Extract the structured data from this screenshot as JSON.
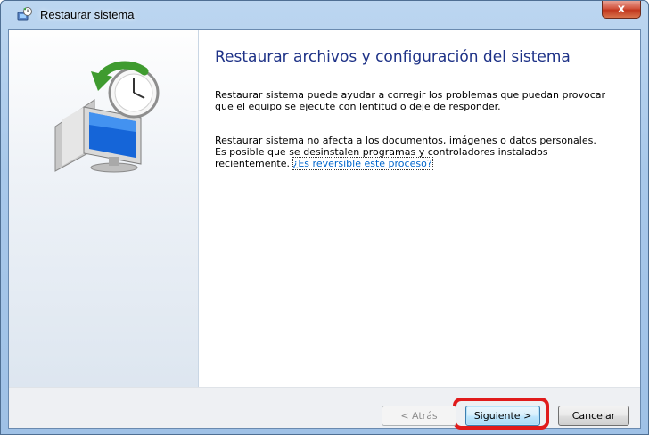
{
  "window": {
    "title": "Restaurar sistema",
    "close_symbol": "x"
  },
  "icons": {
    "title": "system-restore-icon",
    "hero": "computer-with-clock-restore-icon"
  },
  "main": {
    "heading": "Restaurar archivos y configuración del sistema",
    "paragraph1": "Restaurar sistema puede ayudar a corregir los problemas que puedan provocar que el equipo se ejecute con lentitud o deje de responder.",
    "paragraph2_text": "Restaurar sistema no afecta a los documentos, imágenes o datos personales. Es posible que se desinstalen programas y controladores instalados recientemente. ",
    "paragraph2_link": "¿Es reversible este proceso?"
  },
  "footer": {
    "back_label": "< Atrás",
    "next_label": "Siguiente >",
    "cancel_label": "Cancelar"
  },
  "colors": {
    "heading": "#1e3287",
    "link": "#0066cc",
    "highlight": "#e01b1b"
  }
}
